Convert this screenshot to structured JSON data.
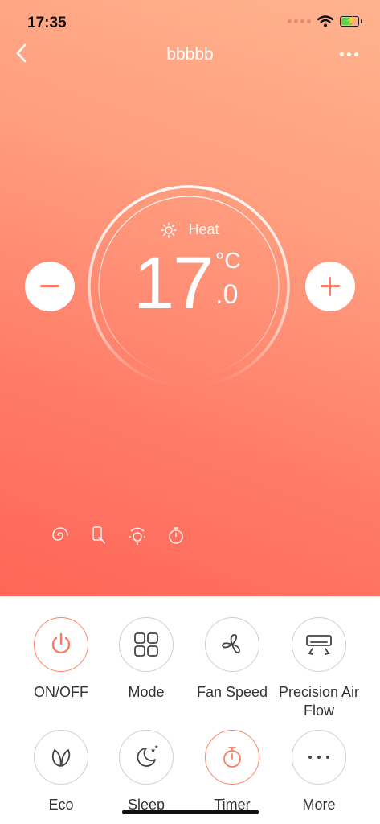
{
  "status_bar": {
    "time": "17:35"
  },
  "header": {
    "title": "bbbbb"
  },
  "thermostat": {
    "mode_label": "Heat",
    "temperature": "17",
    "unit": "°C",
    "decimal": ".0"
  },
  "controls": [
    {
      "label": "ON/OFF",
      "icon": "power-icon",
      "active": true
    },
    {
      "label": "Mode",
      "icon": "grid-icon",
      "active": false
    },
    {
      "label": "Fan Speed",
      "icon": "fan-icon",
      "active": false
    },
    {
      "label": "Precision Air Flow",
      "icon": "air-flow-icon",
      "active": false
    },
    {
      "label": "Eco",
      "icon": "leaf-icon",
      "active": false
    },
    {
      "label": "Sleep",
      "icon": "moon-icon",
      "active": false
    },
    {
      "label": "Timer",
      "icon": "timer-icon",
      "active": true
    },
    {
      "label": "More",
      "icon": "more-icon",
      "active": false
    }
  ],
  "colors": {
    "accent": "#ff7a66",
    "gradient_top": "#ffb38e",
    "gradient_bottom": "#ff6656"
  }
}
